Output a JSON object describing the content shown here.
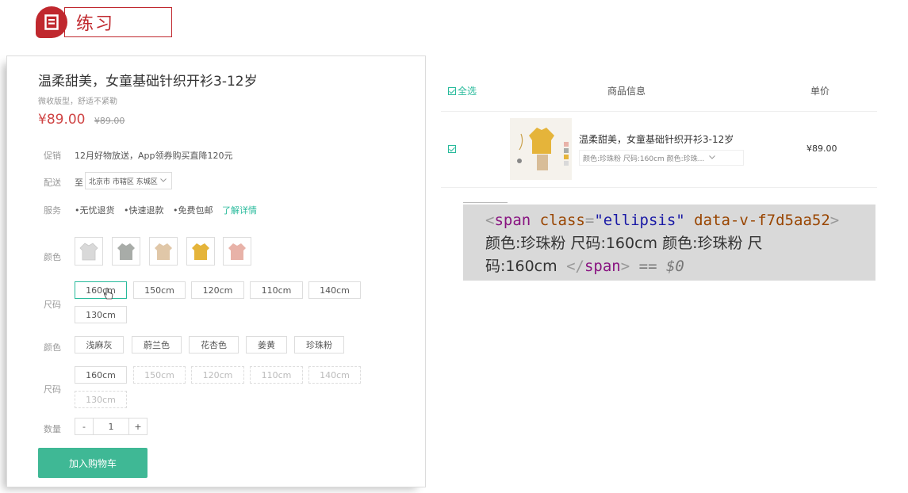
{
  "header": {
    "title": "练习"
  },
  "product": {
    "title": "温柔甜美，女童基础针织开衫3-12岁",
    "subtitle": "微收版型，舒适不紧勒",
    "price": "¥89.00",
    "old_price": "¥89.00",
    "promo_label": "促销",
    "promo_text": "12月好物放送，App领券购买直降120元",
    "delivery_label": "配送",
    "delivery_to": "至",
    "delivery_address": "北京市 市辖区 东城区",
    "service_label": "服务",
    "services": [
      "•无忧退货",
      "•快速退款",
      "•免费包邮"
    ],
    "service_more": "了解详情",
    "color_label": "颜色",
    "size_label": "尺码",
    "quantity_label": "数量",
    "size_options_1": [
      "160cm",
      "150cm",
      "120cm",
      "110cm",
      "140cm",
      "130cm"
    ],
    "color_options": [
      "浅麻灰",
      "蔚兰色",
      "花杏色",
      "姜黄",
      "珍珠粉"
    ],
    "size_options_2": [
      "160cm",
      "150cm",
      "120cm",
      "110cm",
      "140cm",
      "130cm"
    ],
    "quantity": {
      "minus": "-",
      "value": "1",
      "plus": "+"
    },
    "add_to_cart": "加入购物车",
    "swatch_colors": [
      "#d9d9d9",
      "#a8aca8",
      "#e0c7a8",
      "#e5b43a",
      "#e8b2a8"
    ]
  },
  "cart": {
    "select_all": "全选",
    "col_info": "商品信息",
    "col_price": "单价",
    "item": {
      "name": "温柔甜美，女童基础针织开衫3-12岁",
      "attrs": "颜色:珍珠粉 尺码:160cm 颜色:珍珠...",
      "price": "¥89.00"
    }
  },
  "devtools": {
    "tag": "span",
    "attr_name": "class",
    "attr_value": "\"ellipsis\"",
    "scope_attr": "data-v-f7d5aa52",
    "line2": "颜色:珍珠粉 尺码:160cm 颜色:珍珠粉 尺",
    "line3": "码:160cm",
    "suffix": "== $0"
  },
  "colors": {
    "accent": "#27ba9b",
    "price": "#cf4444",
    "brand_red": "#c0282e",
    "button": "#3fb895"
  }
}
